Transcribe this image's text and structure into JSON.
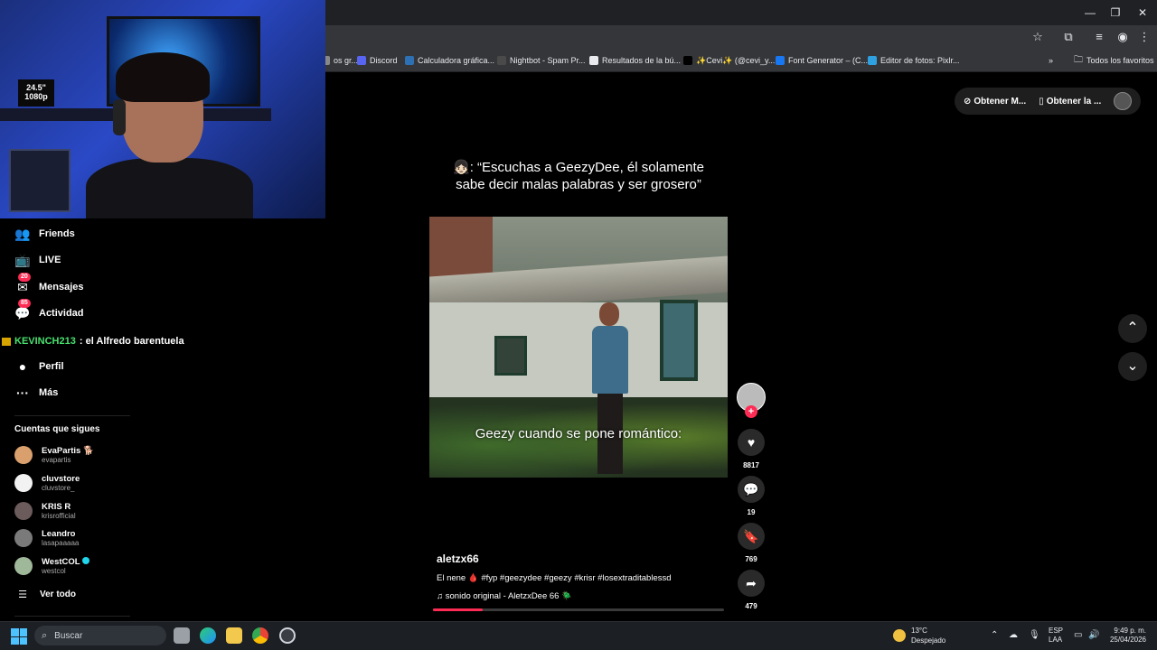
{
  "browser": {
    "window_controls": {
      "minimize": "—",
      "restore": "❐",
      "close": "✕"
    },
    "bookmarks": [
      {
        "label": "os gr...",
        "color": "#888888"
      },
      {
        "label": "Discord",
        "color": "#5865f2"
      },
      {
        "label": "Calculadora gráfica...",
        "color": "#2d70b3"
      },
      {
        "label": "Nightbot - Spam Pr...",
        "color": "#4a4a4a"
      },
      {
        "label": "Resultados de la bú...",
        "color": "#e8eaed"
      },
      {
        "label": "✨Cevi✨ (@cevi_y...",
        "color": "#000000"
      },
      {
        "label": "Font Generator – (C...",
        "color": "#1877f2"
      },
      {
        "label": "Editor de fotos: Pixlr...",
        "color": "#2fa0e0"
      }
    ],
    "all_favorites": "Todos los favoritos"
  },
  "webcam": {
    "sticker": "24.5\" 1080p"
  },
  "sidebar": {
    "nav": [
      {
        "label": "Friends",
        "icon": "friends-icon",
        "glyph": "👥"
      },
      {
        "label": "LIVE",
        "icon": "live-icon",
        "glyph": "📺"
      },
      {
        "label": "Mensajes",
        "icon": "messages-icon",
        "glyph": "✉",
        "badge": "20"
      },
      {
        "label": "Actividad",
        "icon": "activity-icon",
        "glyph": "💬",
        "badge": "85"
      },
      {
        "label": "Perfil",
        "icon": "profile-icon",
        "glyph": "●"
      },
      {
        "label": "Más",
        "icon": "more-icon",
        "glyph": "···"
      }
    ],
    "chat_overlay": {
      "user": "KEVINCH213",
      "message": ": el Alfredo barentuela"
    },
    "following_header": "Cuentas que sigues",
    "accounts": [
      {
        "name": "EvaPartis 🐕",
        "handle": "evapartis",
        "color": "#d9a06e"
      },
      {
        "name": "cluvstore",
        "handle": "cluvstore_",
        "color": "#f2f2f2"
      },
      {
        "name": "KRIS R",
        "handle": "krisrofficial",
        "color": "#6b5b5b"
      },
      {
        "name": "Leandro",
        "handle": "lasapaaaaa",
        "color": "#7a7a7a"
      },
      {
        "name": "WestCOL",
        "handle": "westcol",
        "color": "#a0b89a",
        "verified": true
      }
    ],
    "see_all": "Ver todo"
  },
  "top_pill": {
    "get_pc": "Obtener M...",
    "get_app": "Obtener la ..."
  },
  "video": {
    "top_caption": "👧🏻: “Escuchas a GeezyDee, él solamente sabe decir malas palabras y ser grosero”",
    "overlay_caption": "Geezy cuando se pone romántico:",
    "username": "aletzx66",
    "description": "El nene 🩸 #fyp #geezydee #geezy #krisr #losextraditablessd",
    "music": "♫  sonido original - AletzxDee 66 🪲",
    "progress": 0.17,
    "counts": {
      "likes": "8817",
      "comments": "19",
      "saves": "769",
      "shares": "479"
    }
  },
  "taskbar": {
    "search_placeholder": "Buscar",
    "weather_temp": "13°C",
    "weather_desc": "Despejado",
    "lang_1": "ESP",
    "lang_2": "LAA",
    "time": "9:49 p. m.",
    "date": "25/04/2026"
  }
}
